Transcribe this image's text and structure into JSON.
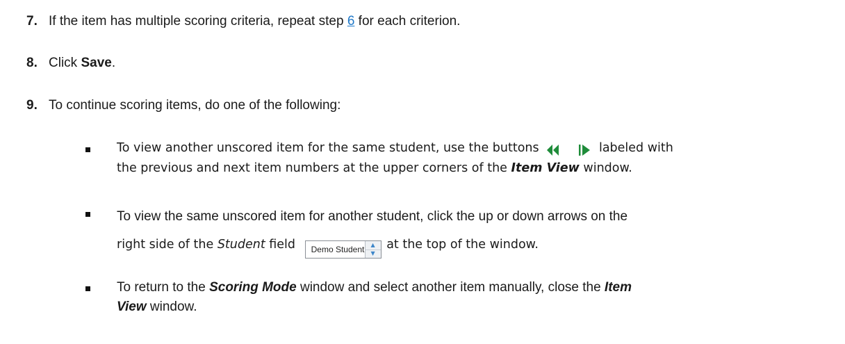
{
  "steps": [
    {
      "number": "7.",
      "before": "If the item has multiple scoring criteria, repeat step ",
      "link": "6",
      "after": " for each criterion."
    },
    {
      "number": "8.",
      "before": "Click ",
      "bold": "Save",
      "after": "."
    },
    {
      "number": "9.",
      "text": "To continue scoring items, do one of the following:"
    }
  ],
  "bullets": [
    {
      "line1_before": "To view another unscored item for the same student, use the buttons",
      "line1_after": "labeled with",
      "line2_before": "the previous and next item numbers at the upper corners of the ",
      "line2_emph": "Item View",
      "line2_after": " window."
    },
    {
      "line1": "To view the same unscored item for another student, click the up or down arrows on the",
      "line2_before": "right side of the ",
      "line2_italic": "Student",
      "line2_mid": " field",
      "line2_after": "at the top of the window."
    },
    {
      "line1_before": "To return to the ",
      "line1_emph": "Scoring Mode",
      "line1_mid": " window and select another item manually, close the ",
      "line1_emph2": "Item",
      "line2_emph": "View",
      "line2_after": " window."
    }
  ],
  "student_field": {
    "value": "Demo Student",
    "up_arrow": "▲",
    "down_arrow": "▼"
  },
  "icons": {
    "prev_button": "double-left-arrow-icon",
    "next_button": "right-arrow-icon",
    "accent_color": "#1f8c3a"
  }
}
